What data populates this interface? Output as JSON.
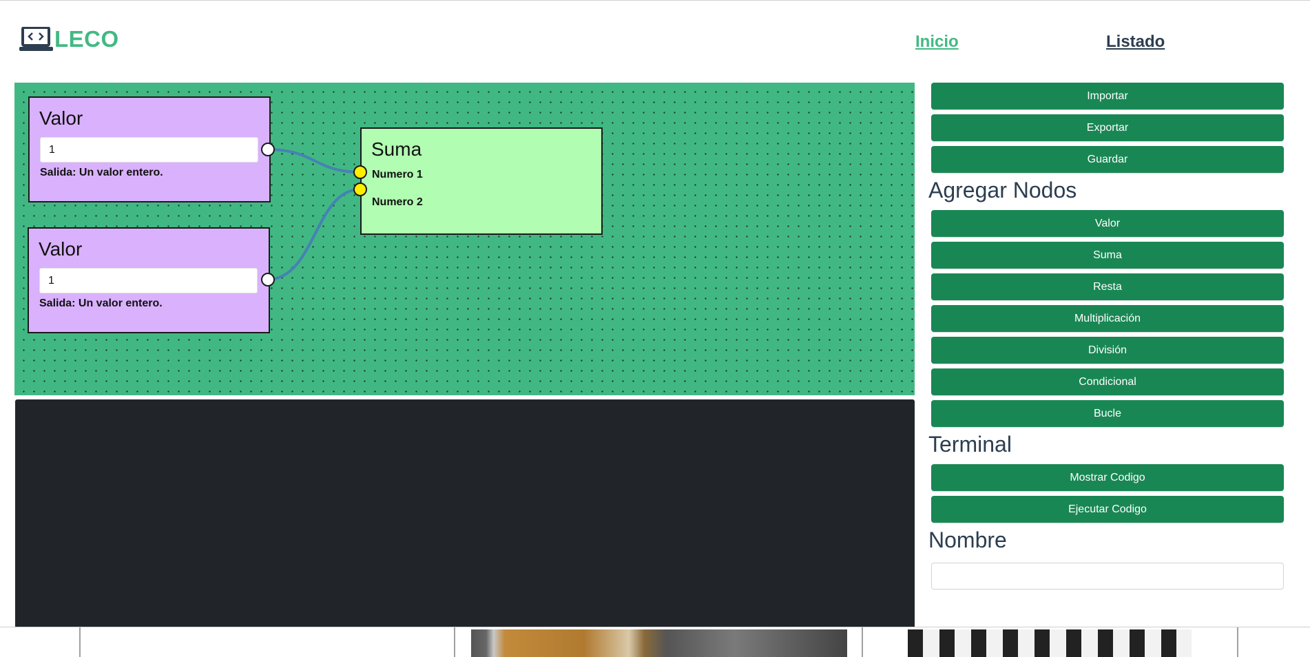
{
  "header": {
    "logo_text": "LECO",
    "logo_icon": "laptop-code-icon",
    "nav": {
      "inicio": "Inicio",
      "listado": "Listado"
    },
    "colors": {
      "brand": "#42b983",
      "nav_dark": "#2c3e50"
    }
  },
  "editor": {
    "nodes": {
      "valor1": {
        "title": "Valor",
        "value": "1",
        "desc": "Salida: Un valor entero."
      },
      "valor2": {
        "title": "Valor",
        "value": "1",
        "desc": "Salida: Un valor entero."
      },
      "suma": {
        "title": "Suma",
        "input1": "Numero 1",
        "input2": "Numero 2"
      }
    },
    "colors": {
      "canvas": "#41b883",
      "valor_node": "#d9b1fd",
      "suma_node": "#b1fdb2",
      "wire": "#4682b4",
      "port_in": "#ffee00"
    }
  },
  "sidebar": {
    "file_buttons": {
      "importar": "Importar",
      "exportar": "Exportar",
      "guardar": "Guardar"
    },
    "add_nodes_title": "Agregar Nodos",
    "node_buttons": {
      "valor": "Valor",
      "suma": "Suma",
      "resta": "Resta",
      "multiplicacion": "Multiplicación",
      "division": "División",
      "condicional": "Condicional",
      "bucle": "Bucle"
    },
    "terminal_title": "Terminal",
    "terminal_buttons": {
      "mostrar": "Mostrar Codigo",
      "ejecutar": "Ejecutar Codigo"
    },
    "nombre_title": "Nombre",
    "nombre_value": ""
  }
}
